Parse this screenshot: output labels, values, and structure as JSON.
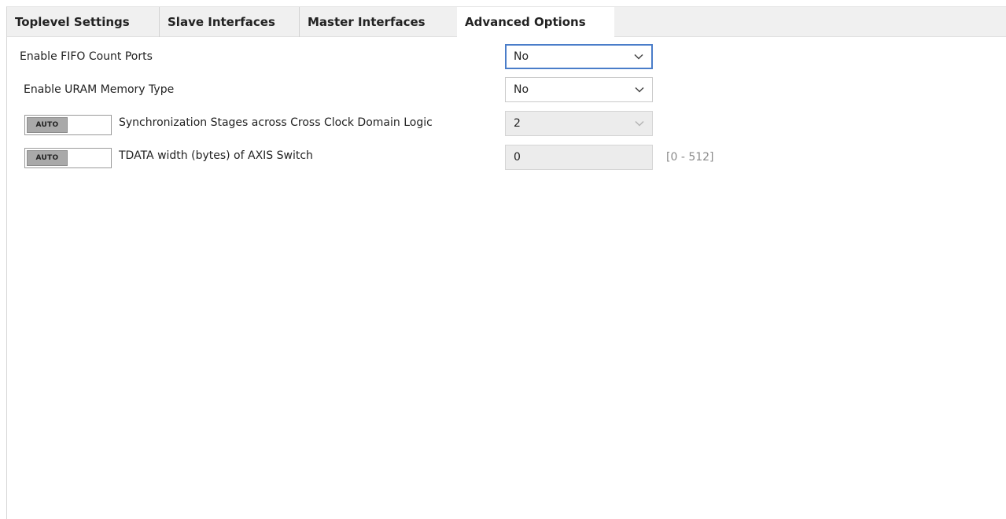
{
  "tabs": [
    {
      "label": "Toplevel Settings"
    },
    {
      "label": "Slave Interfaces"
    },
    {
      "label": "Master Interfaces"
    },
    {
      "label": "Advanced Options"
    }
  ],
  "active_tab": "Advanced Options",
  "options": {
    "fifo_count": {
      "label": "Enable FIFO Count Ports",
      "value": "No"
    },
    "uram": {
      "label": "Enable URAM Memory Type",
      "value": "No"
    },
    "sync_stages": {
      "toggle": "AUTO",
      "label": "Synchronization Stages across Cross Clock Domain Logic",
      "value": "2"
    },
    "tdata_width": {
      "toggle": "AUTO",
      "label": "TDATA width (bytes) of AXIS Switch",
      "value": "0",
      "range": "[0 - 512]"
    }
  },
  "colors": {
    "focus_border": "#4a7dc9",
    "disabled_bg": "#ececec",
    "tabbar_bg": "#f0f0f0"
  },
  "icons": {
    "dropdown": "chevron-down-icon"
  }
}
